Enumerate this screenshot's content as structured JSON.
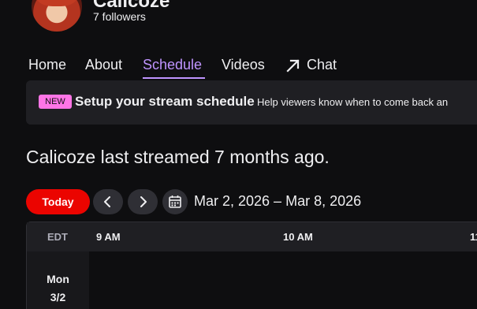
{
  "channel": {
    "name": "Calicoze",
    "followers": "7 followers"
  },
  "tabs": [
    {
      "label": "Home"
    },
    {
      "label": "About"
    },
    {
      "label": "Schedule"
    },
    {
      "label": "Videos"
    },
    {
      "label": "Chat"
    }
  ],
  "banner": {
    "badge": "NEW",
    "title": "Setup your stream schedule",
    "subtitle": "Help viewers know when to come back an"
  },
  "last_streamed": "Calicoze last streamed 7 months ago.",
  "schedule": {
    "today_label": "Today",
    "date_range": "Mar 2, 2026 – Mar 8, 2026",
    "timezone": "EDT",
    "times": [
      "9 AM",
      "10 AM",
      "11"
    ],
    "days": [
      {
        "name": "Mon",
        "date": "3/2"
      }
    ]
  },
  "colors": {
    "background": "#0e0e10",
    "accent": "#bf94ff",
    "today_button": "#eb0400",
    "new_badge": "#ff75e6"
  },
  "icons": [
    "chevron-left-icon",
    "chevron-right-icon",
    "calendar-icon",
    "popout-arrow-icon"
  ]
}
